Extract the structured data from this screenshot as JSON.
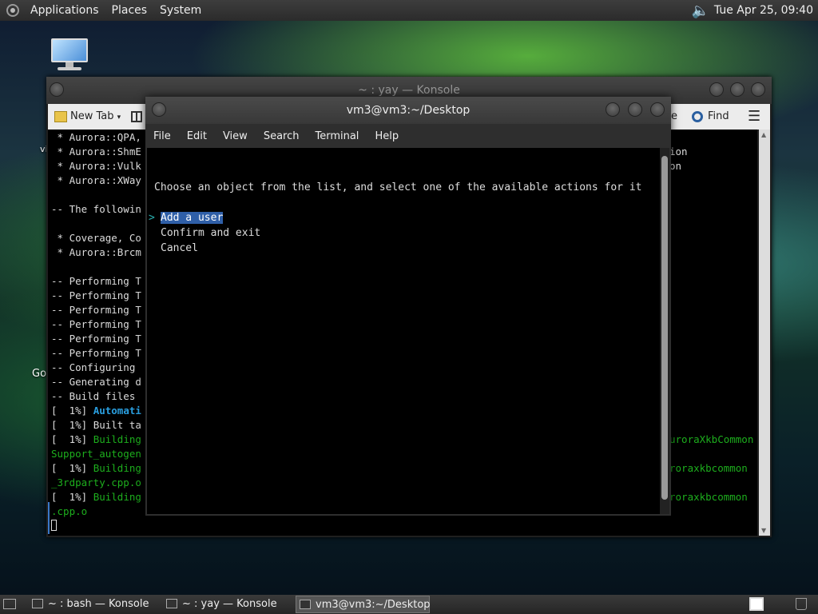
{
  "top_panel": {
    "menus": [
      "Applications",
      "Places",
      "System"
    ],
    "clock": "Tue Apr 25, 09:40"
  },
  "desktop": {
    "fragments": [
      "Go",
      "vi"
    ]
  },
  "konsole_back": {
    "title": "~ : yay — Konsole",
    "toolbar": {
      "new_tab": "New Tab",
      "find": "Find",
      "partial": "e"
    },
    "lines": [
      " * Aurora::QPA,",
      " * Aurora::ShmE",
      " * Aurora::Vulk",
      " * Aurora::XWay",
      "",
      "-- The followin",
      "",
      " * Coverage, Co",
      " * Aurora::Brcm",
      "",
      "-- Performing T",
      "-- Performing T",
      "-- Performing T",
      "-- Performing T",
      "-- Performing T",
      "-- Performing T",
      "-- Configuring",
      "-- Generating d",
      "-- Build files"
    ],
    "right_lines": [
      "ion",
      "on"
    ],
    "progress_lines": [
      {
        "prefix": "[  1%] ",
        "text": "Automati",
        "style": "blue"
      },
      {
        "prefix": "[  1%] ",
        "text": "Built ta",
        "style": "plain"
      },
      {
        "prefix": "[  1%] ",
        "text": "Building",
        "style": "green",
        "right": "uroraXkbCommon"
      },
      {
        "prefix": "",
        "text": "Support_autogen",
        "style": "green"
      },
      {
        "prefix": "[  1%] ",
        "text": "Building",
        "style": "green",
        "right": "roraxkbcommon"
      },
      {
        "prefix": "",
        "text": "_3rdparty.cpp.o",
        "style": "green"
      },
      {
        "prefix": "[  1%] ",
        "text": "Building",
        "style": "green",
        "right": "roraxkbcommon"
      },
      {
        "prefix": "",
        "text": ".cpp.o",
        "style": "green"
      }
    ]
  },
  "front_window": {
    "title": "vm3@vm3:~/Desktop",
    "menu": [
      "File",
      "Edit",
      "View",
      "Search",
      "Terminal",
      "Help"
    ],
    "prompt": "Choose an object from the list, and select one of the available actions for it",
    "marker": ">",
    "options": [
      "Add a user",
      "Confirm and exit",
      "Cancel"
    ],
    "selected_index": 0
  },
  "taskbar": {
    "tasks": [
      "~ : bash — Konsole",
      "~ : yay — Konsole",
      "vm3@vm3:~/Desktop"
    ],
    "active_index": 2
  },
  "colors": {
    "selection": "#2f5fa8",
    "green_text": "#1dae1d",
    "blue_text": "#2a9fe0"
  }
}
